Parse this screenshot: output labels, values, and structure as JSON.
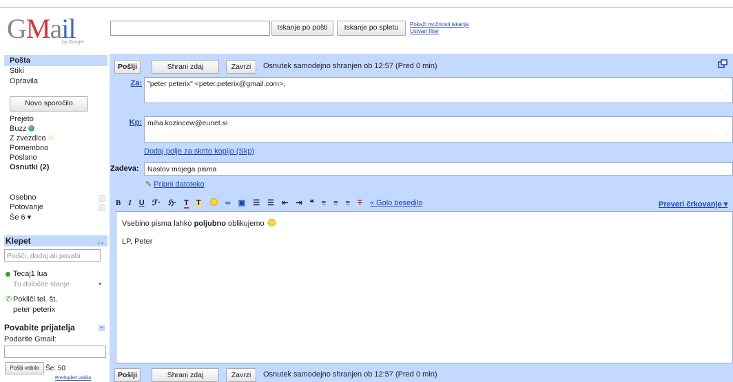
{
  "logo": {
    "text": "Gmail",
    "byline": "by Google"
  },
  "search": {
    "search_mail": "Iskanje po pošti",
    "search_web": "Iskanje po spletu",
    "show_options": "Pokaži možnosti iskanja",
    "create_filter": "Ustvari filter"
  },
  "sidebar": {
    "top": [
      "Pošta",
      "Stiki",
      "Opravila"
    ],
    "new_message": "Novo sporočilo",
    "folders": {
      "inbox": "Prejeto",
      "buzz": "Buzz",
      "starred": "Z zvezdico",
      "important": "Pomembno",
      "sent": "Poslano",
      "drafts": "Osnutki (2)"
    },
    "labels": [
      "Osebno",
      "Potovanje"
    ],
    "more": "Še 6 ▾"
  },
  "chat": {
    "title": "Klepet",
    "controls": "▪ ▪",
    "search_placeholder": "Poišči, dodaj ali povabi",
    "user_name": "Tecaj1 lua",
    "status_prompt": "Tu določite stanje",
    "call_phone": "Pokliči tel. št.",
    "contact": "peter peterix"
  },
  "invite": {
    "title": "Povabite prijatelja",
    "subtitle": "Podarite Gmail:",
    "send_button": "Pošlji vabilo",
    "remaining": "Še: 50",
    "preview": "Predogled vabila"
  },
  "compose": {
    "send": "Pošlji",
    "save_now": "Shrani zdaj",
    "discard": "Zavrzi",
    "draft_status": "Osnutek samodejno shranjen ob 12:57 (Pred 0 min)",
    "to_label": "Za:",
    "to_value": "\"peter peterix\" <peter.peterix@gmail.com>,",
    "cc_label": "Kp:",
    "cc_value": "miha.kozincew@eunet.si",
    "add_bcc": "Dodaj polje za skrito kopijo (Skp)",
    "subject_label": "Zadeva:",
    "subject_value": "Naslov mojega pisma",
    "attach": "Pripni datoteko",
    "plain_text": "« Golo besedilo",
    "spellcheck": "Preveri črkovanje ▾",
    "body_prefix": "Vsebino pisma lahko ",
    "body_bold": "poljubno",
    "body_suffix": " oblikujemo",
    "signature": "LP, Peter"
  },
  "toolbar_glyphs": {
    "bold": "B",
    "italic": "I",
    "underline": "U",
    "font": "ℱ·",
    "size": "ℌ·",
    "text_color": "T",
    "highlight": "T"
  },
  "colors": {
    "accent_blue": "#c3d9ff",
    "link": "#2244bb",
    "logo_red": "#dd3333"
  }
}
